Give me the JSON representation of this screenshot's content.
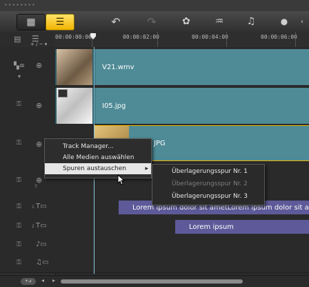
{
  "toolbar": {
    "buttons": [
      {
        "name": "storyboard-view-icon",
        "glyph": "▦"
      },
      {
        "name": "timeline-view-icon",
        "glyph": "☰"
      },
      {
        "name": "undo-icon",
        "glyph": "↶"
      },
      {
        "name": "redo-icon",
        "glyph": "↷"
      },
      {
        "name": "record-capture-icon",
        "glyph": "✿"
      },
      {
        "name": "sound-mixer-icon",
        "glyph": "♒"
      },
      {
        "name": "auto-music-icon",
        "glyph": "♫"
      },
      {
        "name": "more-icon",
        "glyph": "●"
      }
    ]
  },
  "ruler": {
    "ticks": [
      "00:00:00:00",
      "00:00:02:00",
      "00:00:04:00",
      "00:00:06:00"
    ],
    "add_track": "+ / − ▾"
  },
  "tracks": {
    "clips": [
      {
        "label": "V21.wmv"
      },
      {
        "label": "I05.jpg"
      },
      {
        "label": "JPG"
      },
      {
        "label": "Lorem ipsum dolor sit ametLorem ipsum dolor sit ame"
      },
      {
        "label": "Lorem ipsum"
      }
    ],
    "track_numbers": [
      "3",
      "1",
      "2"
    ]
  },
  "context_menu": {
    "items": [
      {
        "label": "Track Manager..."
      },
      {
        "label": "Alle Medien auswählen"
      },
      {
        "label": "Spuren austauschen",
        "arrow": "▸"
      }
    ]
  },
  "submenu": {
    "items": [
      {
        "label": "Überlagerungsspur Nr. 1",
        "enabled": true
      },
      {
        "label": "Überlagerungsspur Nr. 2",
        "enabled": false
      },
      {
        "label": "Überlagerungsspur Nr. 3",
        "enabled": true
      }
    ]
  },
  "colors": {
    "video_clip": "#4f8b96",
    "title_clip": "#5e5a99",
    "accent": "#f0b400"
  }
}
